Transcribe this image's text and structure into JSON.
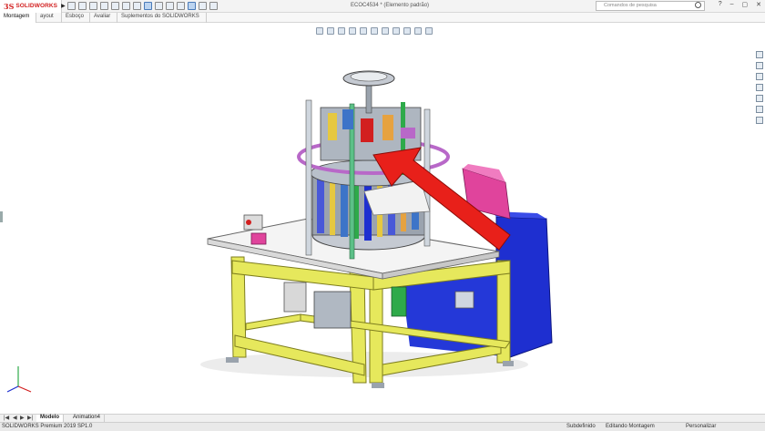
{
  "app": {
    "logo_ds": "3S",
    "logo_text": "SOLIDWORKS",
    "title": "ECOC4534 * (Elemento padrão)",
    "search_placeholder": "Comandos de pesquisa"
  },
  "window_buttons": [
    "?",
    "–",
    "▢",
    "✕"
  ],
  "command_tabs": [
    "Montagem",
    "ayout",
    "Esboço",
    "Avaliar",
    "Suplementos do SOLIDWORKS"
  ],
  "bottom_tabs": [
    "Modelo",
    "Animation4"
  ],
  "status": {
    "left": "SOLIDWORKS Premium 2019 SP1.0",
    "subdefined": "Subdefinido",
    "editing": "Editando Montagem",
    "custom": "Personalizar"
  },
  "colors": {
    "arrow": "#e8201a",
    "frame": "#e6e85c",
    "table": "#f4f4f4",
    "cabinet": "#1e2fd0",
    "magenta_box": "#e0449c"
  }
}
